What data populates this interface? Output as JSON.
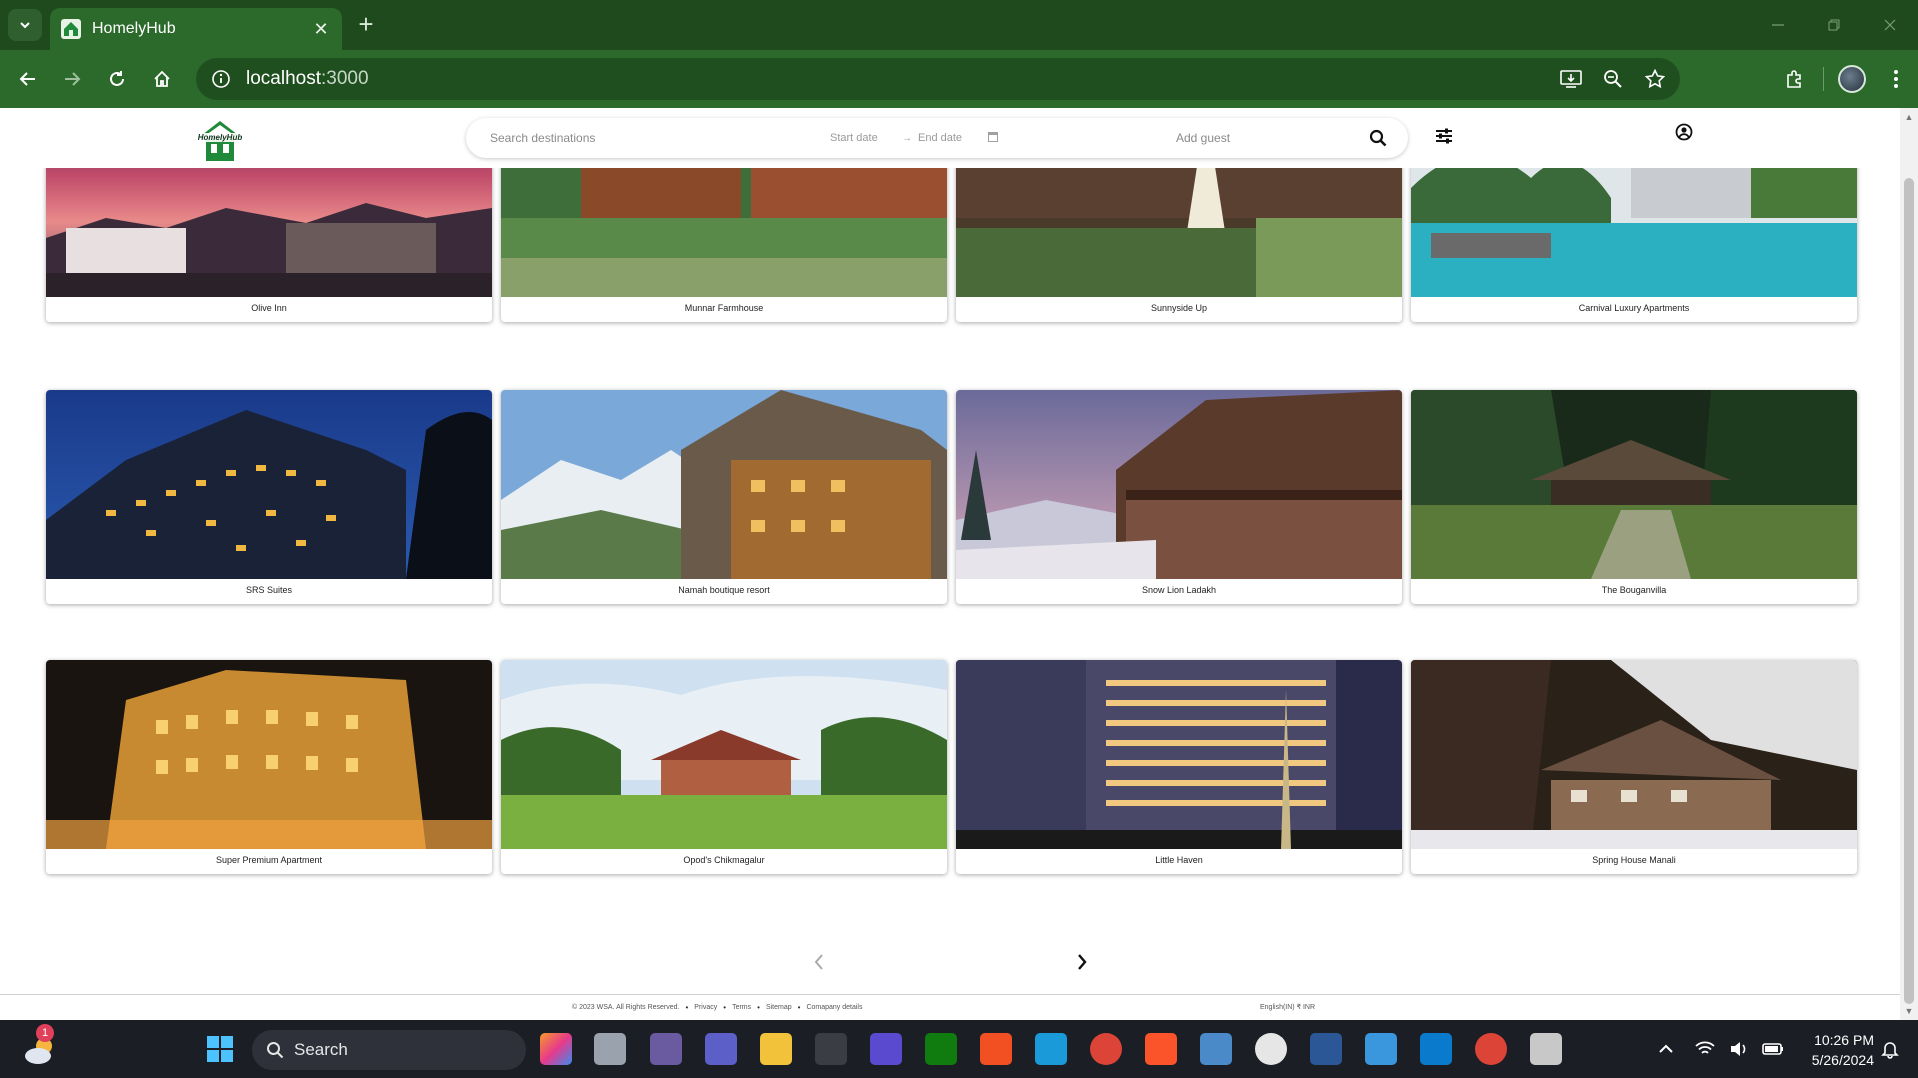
{
  "browser": {
    "tab_title": "HomelyHub",
    "url_host": "localhost",
    "url_port": ":3000"
  },
  "header": {
    "logo_text": "HomelyHub",
    "search_placeholder": "Search destinations",
    "start_date": "Start date",
    "date_arrow": "→",
    "end_date": "End date",
    "guest_placeholder": "Add guest"
  },
  "properties": [
    {
      "name": "Olive Inn"
    },
    {
      "name": "Munnar Farmhouse"
    },
    {
      "name": "Sunnyside Up"
    },
    {
      "name": "Carnival Luxury Apartments"
    },
    {
      "name": "SRS Suites"
    },
    {
      "name": "Namah boutique resort"
    },
    {
      "name": "Snow Lion Ladakh"
    },
    {
      "name": "The Bouganvilla"
    },
    {
      "name": "Super Premium Apartment"
    },
    {
      "name": "Opod's Chikmagalur"
    },
    {
      "name": "Little Haven"
    },
    {
      "name": "Spring House Manali"
    }
  ],
  "footer": {
    "copyright": "© 2023 WSA. All Rights Reserved.",
    "privacy": "Privacy",
    "terms": "Terms",
    "sitemap": "Sitemap",
    "company": "Comapany details",
    "locale": "English(IN)   ₹ INR"
  },
  "taskbar": {
    "search_label": "Search",
    "notification_count": "1",
    "time": "10:26 PM",
    "date": "5/26/2024"
  },
  "colors": {
    "browser_dark": "#1e4a1e",
    "browser_green": "#2b6a2b",
    "brand_green": "#1f8a3a",
    "taskbar": "#1b1e24"
  }
}
